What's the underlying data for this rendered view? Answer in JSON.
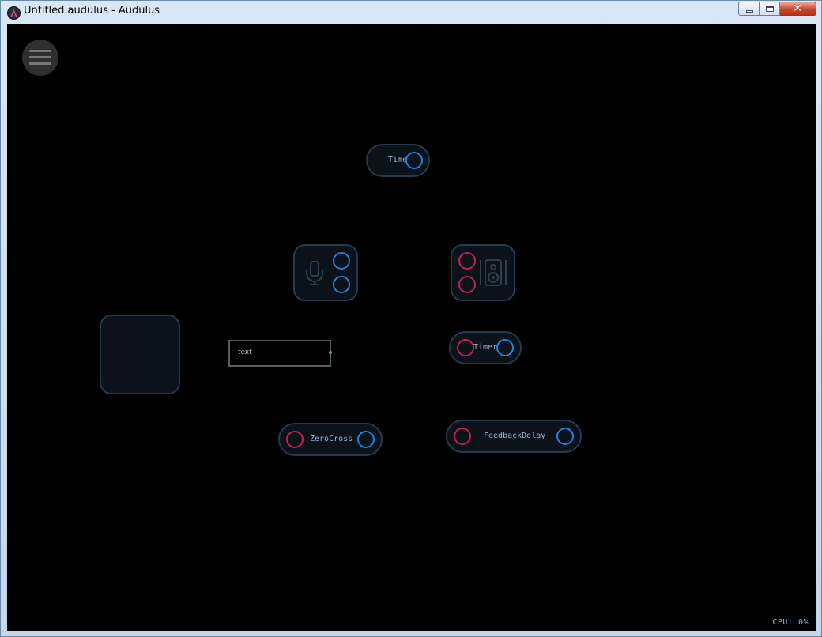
{
  "window": {
    "title": "Untitled.audulus - Audulus",
    "close_glyph": "✕"
  },
  "canvas": {
    "menu_icon": "hamburger-icon",
    "nodes": {
      "timer_top": {
        "label": "Time"
      },
      "audio_input": {
        "icon": "microphone-icon"
      },
      "audio_output": {
        "icon": "speaker-icon"
      },
      "text_box": {
        "label": "text"
      },
      "timer_right": {
        "label": "Timer"
      },
      "zerocross": {
        "label": "ZeroCross"
      },
      "feedback_delay": {
        "label": "FeedbackDelay"
      }
    },
    "status": {
      "cpu": "CPU: 0%"
    }
  },
  "colors": {
    "input_port": "#c41f52",
    "output_port": "#1c84dc",
    "node_border": "#27394b",
    "node_fill": "#0c121a",
    "label_text": "#8fb4d4"
  }
}
